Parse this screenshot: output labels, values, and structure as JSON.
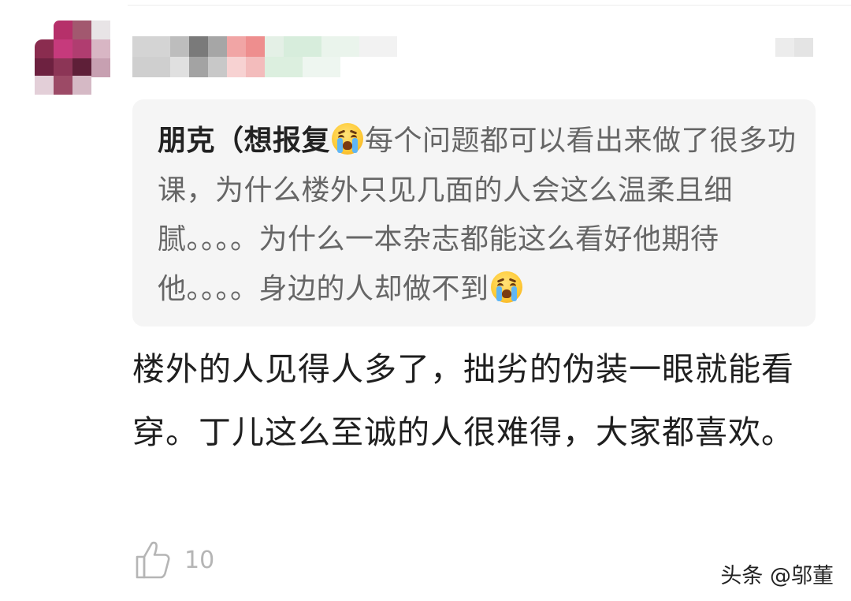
{
  "comment": {
    "quoted": {
      "author": "朋克（想报复",
      "emoji": "crying-face-icon",
      "text_before_emoji": "每个问题都可以看出来做了很多功课，为什么楼外只见几面的人会这么温柔且细腻。。。。为什么一本杂志都能这么看好他期待他。。。。身边的人却做不到",
      "trailing_emoji": "crying-face-icon"
    },
    "reply": {
      "text": "楼外的人见得人多了，拙劣的伪装一眼就能看穿。丁儿这么至诚的人很难得，大家都喜欢。"
    },
    "like_count": "10"
  },
  "watermark": "头条 @邬董",
  "colors": {
    "quote_background": "#f5f5f5",
    "quote_text": "#666666",
    "author_text": "#222222",
    "reply_text": "#1f1f1f",
    "like_gray": "#b5b5b5"
  }
}
